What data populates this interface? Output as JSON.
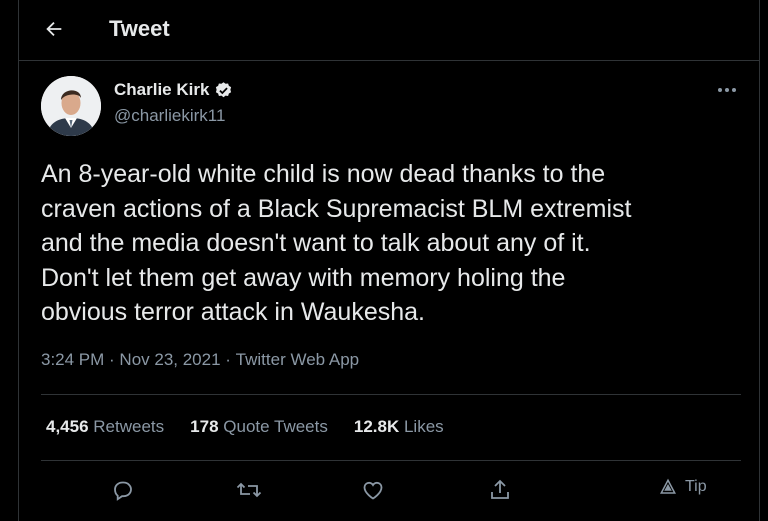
{
  "header": {
    "title": "Tweet"
  },
  "author": {
    "name": "Charlie Kirk",
    "handle": "@charliekirk11",
    "verified": true
  },
  "tweet": {
    "lines": [
      "An 8-year-old white child is now dead thanks to the",
      "craven actions of a Black Supremacist BLM extremist",
      "and the media doesn't want to talk about any of it.",
      "Don't let them get away with memory holing the",
      "obvious terror attack in Waukesha."
    ]
  },
  "meta": {
    "time": "3:24 PM",
    "sep": " · ",
    "date": "Nov 23, 2021",
    "source": "Twitter Web App"
  },
  "stats": {
    "retweets": {
      "count": "4,456",
      "label": "Retweets"
    },
    "quotes": {
      "count": "178",
      "label": "Quote Tweets"
    },
    "likes": {
      "count": "12.8K",
      "label": "Likes"
    }
  },
  "actions": {
    "tip_label": "Tip"
  },
  "colors": {
    "background": "#000000",
    "text": "#e7e9ea",
    "secondary": "#8b98a5",
    "border": "#2f3336"
  },
  "icons": [
    "back-arrow-icon",
    "verified-badge-icon",
    "more-icon",
    "reply-icon",
    "retweet-icon",
    "like-icon",
    "share-icon",
    "tip-icon"
  ]
}
